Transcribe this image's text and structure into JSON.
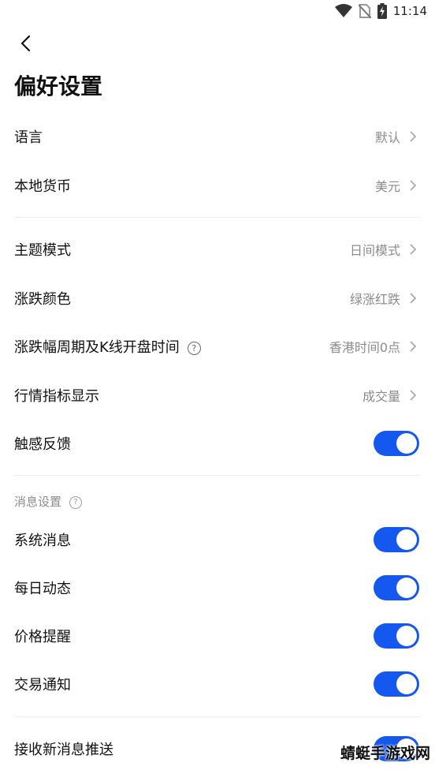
{
  "status_bar": {
    "time": "11:14"
  },
  "header": {
    "title": "偏好设置"
  },
  "general": [
    {
      "label": "语言",
      "value": "默认"
    },
    {
      "label": "本地货币",
      "value": "美元"
    }
  ],
  "display": [
    {
      "label": "主题模式",
      "value": "日间模式"
    },
    {
      "label": "涨跌颜色",
      "value": "绿涨红跌"
    },
    {
      "label": "涨跌幅周期及K线开盘时间",
      "value": "香港时间0点"
    },
    {
      "label": "行情指标显示",
      "value": "成交量"
    }
  ],
  "haptic": {
    "label": "触感反馈",
    "enabled": true
  },
  "message_settings": {
    "section_label": "消息设置",
    "items": [
      {
        "label": "系统消息",
        "enabled": true
      },
      {
        "label": "每日动态",
        "enabled": true
      },
      {
        "label": "价格提醒",
        "enabled": true
      },
      {
        "label": "交易通知",
        "enabled": true
      }
    ]
  },
  "push": {
    "label": "接收新消息推送",
    "enabled": true
  },
  "help_glyph": "?",
  "watermark": "蜻蜓手游戏网"
}
